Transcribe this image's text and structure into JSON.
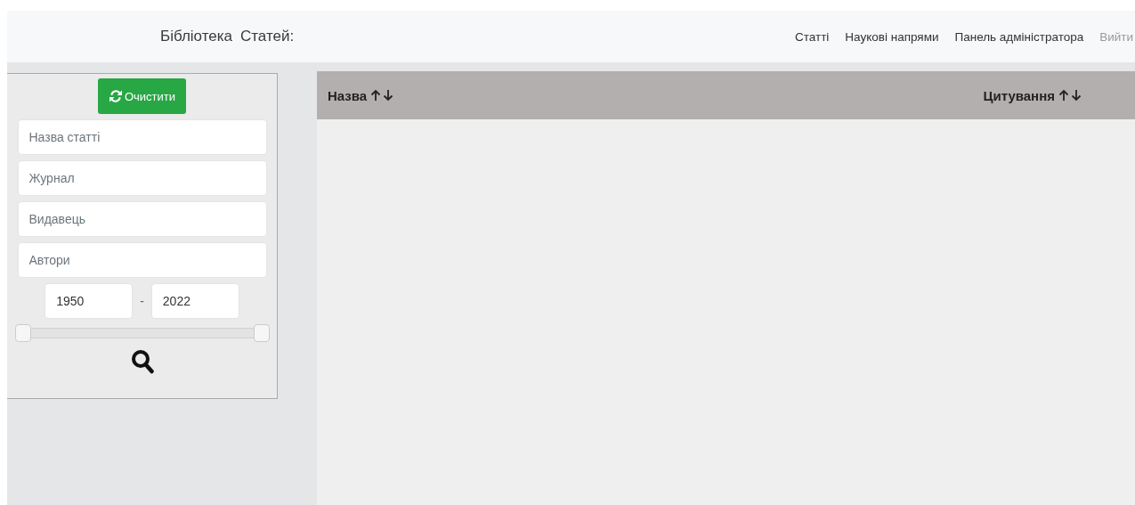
{
  "navbar": {
    "brand": [
      "Бібліотека",
      "Статей:"
    ],
    "links": [
      {
        "label": "Статті",
        "disabled": false
      },
      {
        "label": "Наукові напрями",
        "disabled": false
      },
      {
        "label": "Панель адміністратора",
        "disabled": false
      },
      {
        "label": "Вийти",
        "disabled": true
      }
    ]
  },
  "filters": {
    "clear_button": "Очистити",
    "fields": [
      {
        "placeholder": "Назва статті"
      },
      {
        "placeholder": "Журнал"
      },
      {
        "placeholder": "Видавець"
      },
      {
        "placeholder": "Автори"
      }
    ],
    "year_from": "1950",
    "separator": "-",
    "year_to": "2022",
    "range_thumbs": [
      {
        "level": 0
      },
      {
        "level": 1
      }
    ]
  },
  "table": {
    "columns": [
      {
        "label": "Назва"
      },
      {
        "label": "Цитування"
      }
    ]
  }
}
